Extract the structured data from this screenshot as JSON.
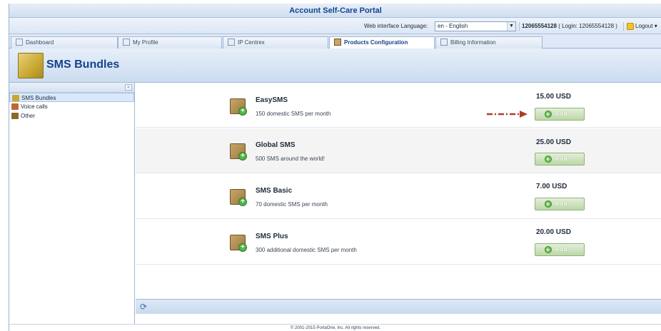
{
  "app": {
    "title": "Account Self-Care Portal"
  },
  "userbar": {
    "language_label": "Web interface Language:",
    "language_value": "en - English",
    "account_number": "12065554128",
    "account_login": "( Login: 12065554128 )",
    "logout_label": "Logout"
  },
  "tabs": [
    {
      "label": "Dashboard",
      "icon": "dashboard-icon",
      "active": false
    },
    {
      "label": "My Profile",
      "icon": "user-icon",
      "active": false
    },
    {
      "label": "IP Centrex",
      "icon": "phone-icon",
      "active": false
    },
    {
      "label": "Products Configuration",
      "icon": "package-icon",
      "active": true
    },
    {
      "label": "Billing Information",
      "icon": "document-icon",
      "active": false
    }
  ],
  "page": {
    "title": "SMS Bundles"
  },
  "sidebar": {
    "items": [
      {
        "label": "SMS Bundles",
        "icon": "sms-folder-icon",
        "color": "#c8a833",
        "selected": true
      },
      {
        "label": "Voice calls",
        "icon": "voice-folder-icon",
        "color": "#c0653a",
        "selected": false
      },
      {
        "label": "Other",
        "icon": "other-folder-icon",
        "color": "#8a6a2a",
        "selected": false
      }
    ]
  },
  "products": [
    {
      "name": "EasySMS",
      "description": "150 domestic SMS per month",
      "price": "15.00 USD",
      "button": "Add"
    },
    {
      "name": "Global SMS",
      "description": "500 SMS around the world!",
      "price": "25.00 USD",
      "button": "Add"
    },
    {
      "name": "SMS Basic",
      "description": "70 domestic SMS per month",
      "price": "7.00 USD",
      "button": "Add"
    },
    {
      "name": "SMS Plus",
      "description": "300 additional domestic SMS per month",
      "price": "20.00 USD",
      "button": "Add"
    }
  ],
  "footer": {
    "copyright": "© 2001-2015 PortaOne, Inc. All rights reserved."
  },
  "colors": {
    "title_text": "#15428b",
    "add_button": "#bcd7a7",
    "annotation_arrow": "#b03a2e"
  }
}
